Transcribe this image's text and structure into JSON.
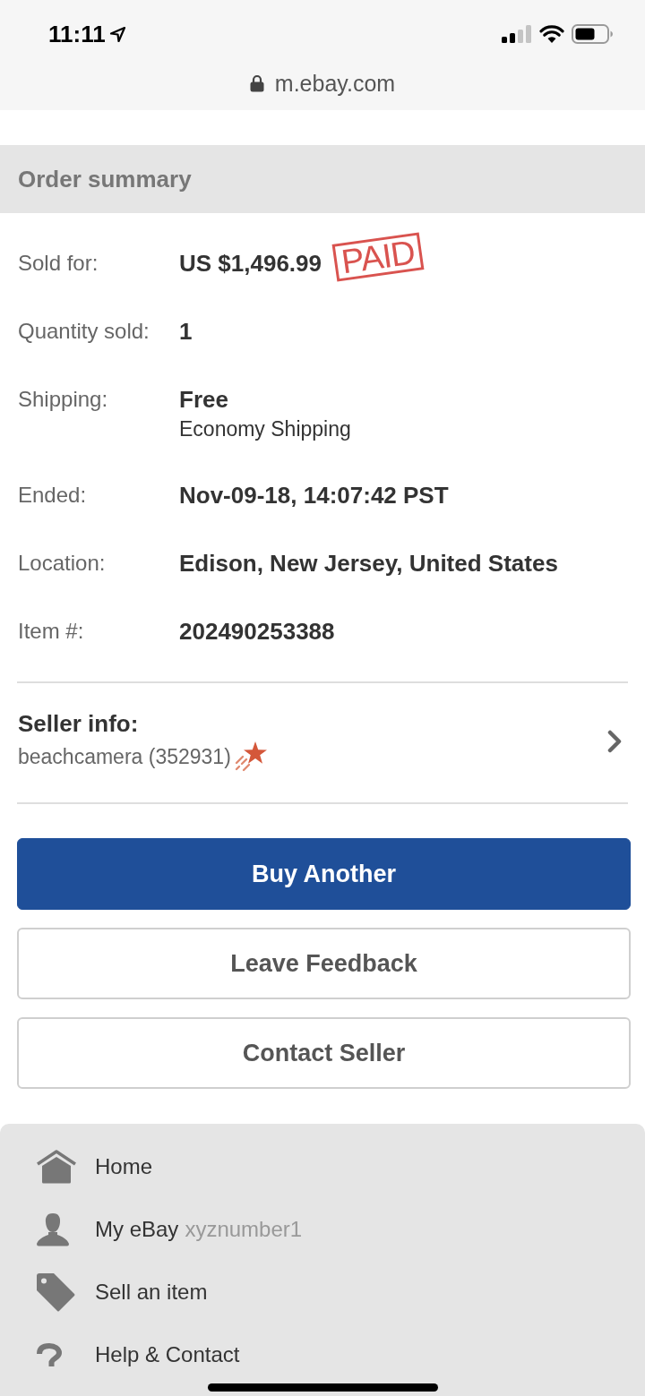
{
  "status_bar": {
    "time": "11:11"
  },
  "browser": {
    "url": "m.ebay.com"
  },
  "order_summary": {
    "title": "Order summary",
    "rows": [
      {
        "label": "Sold for:",
        "value": "US $1,496.99",
        "stamp": "PAID"
      },
      {
        "label": "Quantity sold:",
        "value": "1"
      },
      {
        "label": "Shipping:",
        "value": "Free",
        "detail": "Economy Shipping"
      },
      {
        "label": "Ended:",
        "value": "Nov-09-18, 14:07:42 PST"
      },
      {
        "label": "Location:",
        "value": "Edison, New Jersey, United States"
      },
      {
        "label": "Item #:",
        "value": "202490253388"
      }
    ]
  },
  "seller": {
    "title": "Seller info:",
    "name": "beachcamera (352931)"
  },
  "buttons": [
    {
      "label": "Buy Another",
      "kind": "primary"
    },
    {
      "label": "Leave Feedback",
      "kind": "secondary"
    },
    {
      "label": "Contact Seller",
      "kind": "secondary"
    }
  ],
  "footer_menu": [
    {
      "label": "Home"
    },
    {
      "label": "My eBay",
      "detail": "xyznumber1"
    },
    {
      "label": "Sell an item"
    },
    {
      "label": "Help & Contact"
    }
  ]
}
